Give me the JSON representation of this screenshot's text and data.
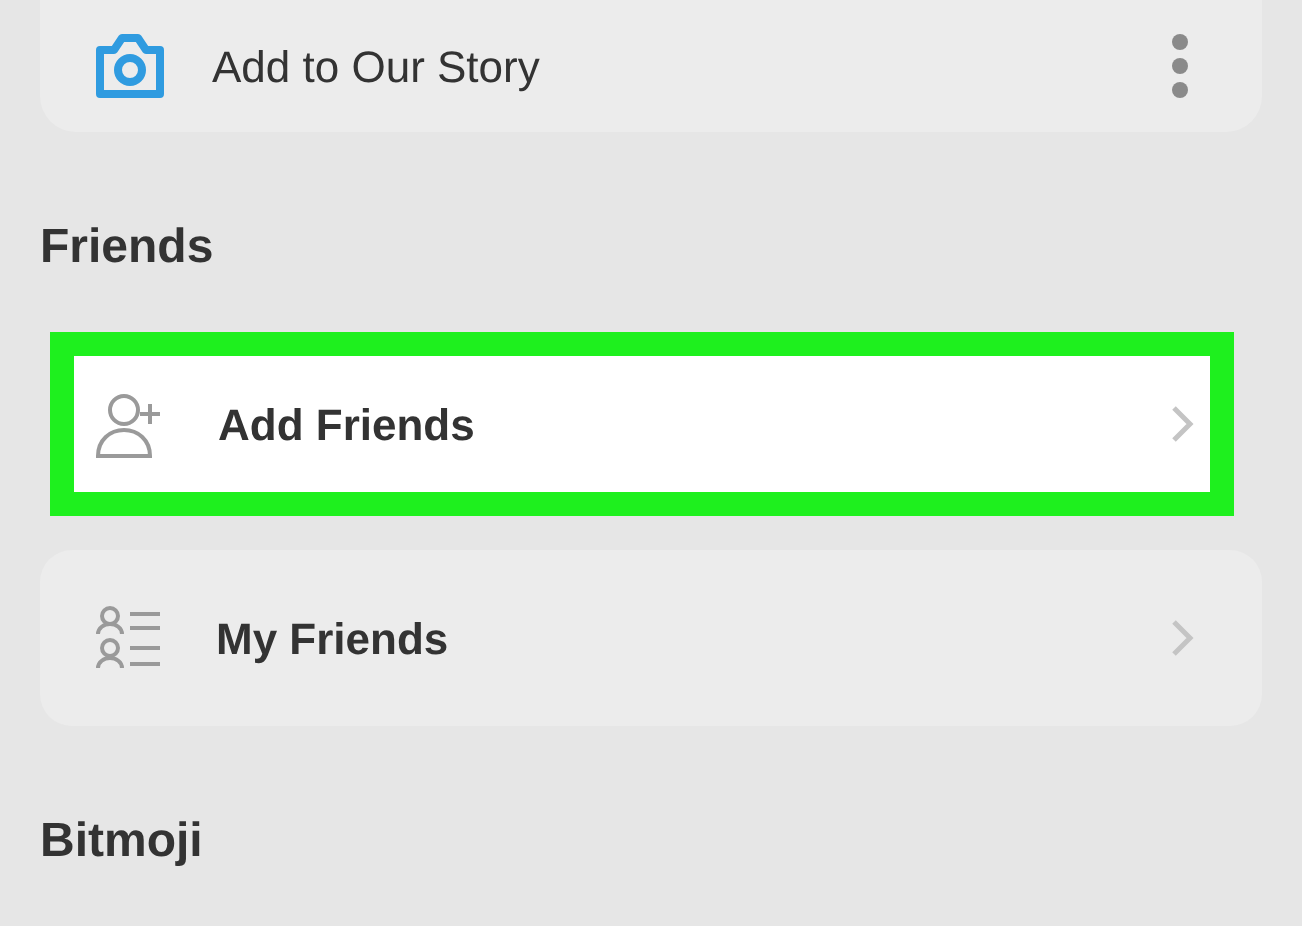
{
  "story_item": {
    "label": "Add to Our Story"
  },
  "sections": [
    {
      "title": "Friends",
      "items": [
        {
          "label": "Add Friends",
          "kind": "add",
          "highlighted": true
        },
        {
          "label": "My Friends",
          "kind": "list",
          "highlighted": false
        }
      ]
    },
    {
      "title": "Bitmoji"
    }
  ]
}
